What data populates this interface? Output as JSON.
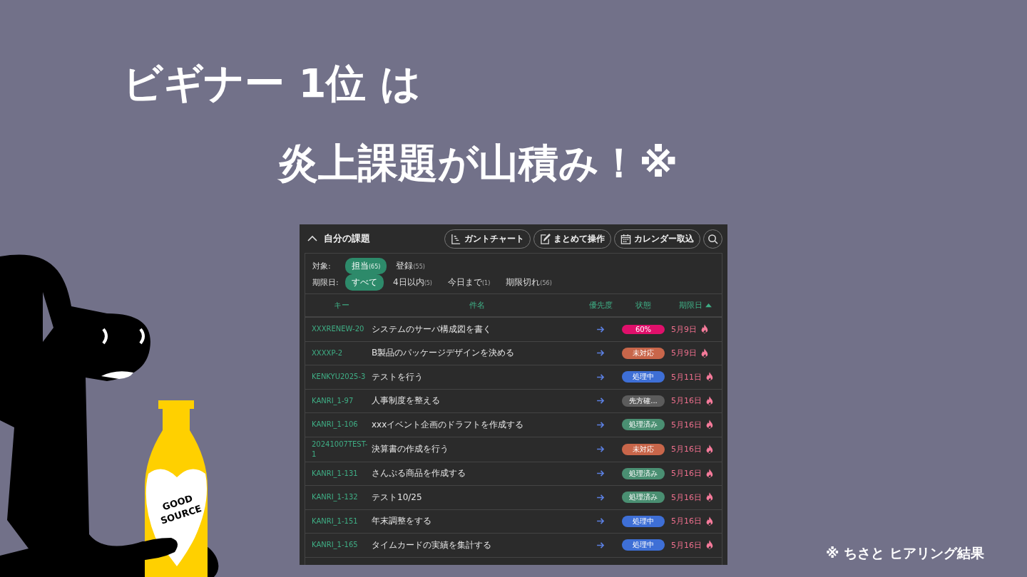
{
  "slide": {
    "title_line_1": "ビギナー 1位 は",
    "title_line_2": "炎上課題が山積み！※",
    "footnote": "※ ちさと ヒアリング結果",
    "bottle_label": [
      "GOOD",
      "SOURCE"
    ]
  },
  "panel": {
    "title": "自分の課題",
    "expanded": true,
    "toolbar": [
      {
        "kind": "gantt",
        "label": "ガントチャート"
      },
      {
        "kind": "bulk",
        "label": "まとめて操作"
      },
      {
        "kind": "calendar",
        "label": "カレンダー取込"
      },
      {
        "kind": "search"
      }
    ],
    "filters": [
      {
        "label": "対象:",
        "options": [
          {
            "label": "担当",
            "count": "(65)",
            "selected": true
          },
          {
            "label": "登録",
            "count": "(55)",
            "selected": false
          }
        ]
      },
      {
        "label": "期限日:",
        "options": [
          {
            "label": "すべて",
            "selected": true
          },
          {
            "label": "4日以内",
            "count": "(5)",
            "selected": false
          },
          {
            "label": "今日まで",
            "count": "(1)",
            "selected": false
          },
          {
            "label": "期限切れ",
            "count": "(56)",
            "selected": false
          }
        ]
      }
    ],
    "table": {
      "columns": [
        {
          "label": "キー"
        },
        {
          "label": "件名"
        },
        {
          "label": "優先度"
        },
        {
          "label": "状態"
        },
        {
          "label": "期限日",
          "sorted": true
        }
      ],
      "rows": [
        {
          "key": "XXXRENEW-20",
          "title": "システムのサーバ構成図を書く",
          "status": "60%",
          "color": "#e0106b",
          "due": "5月9日"
        },
        {
          "key": "XXXXP-2",
          "title": "B製品のパッケージデザインを決める",
          "status": "未対応",
          "color": "#c8664a",
          "due": "5月9日"
        },
        {
          "key": "KENKYU2025-3",
          "title": "テストを行う",
          "status": "処理中",
          "color": "#3e6fd6",
          "due": "5月11日"
        },
        {
          "key": "KANRI_1-97",
          "title": "人事制度を整える",
          "status": "先方確...",
          "color": "#5c5c5c",
          "due": "5月16日"
        },
        {
          "key": "KANRI_1-106",
          "title": "xxxイベント企画のドラフトを作成する",
          "status": "処理済み",
          "color": "#4a8f72",
          "due": "5月16日"
        },
        {
          "key": "20241007TEST-1",
          "title": "決算書の作成を行う",
          "status": "未対応",
          "color": "#c8664a",
          "due": "5月16日"
        },
        {
          "key": "KANRI_1-131",
          "title": "さんぷる商品を作成する",
          "status": "処理済み",
          "color": "#4a8f72",
          "due": "5月16日"
        },
        {
          "key": "KANRI_1-132",
          "title": "テスト10/25",
          "status": "処理済み",
          "color": "#4a8f72",
          "due": "5月16日"
        },
        {
          "key": "KANRI_1-151",
          "title": "年末調整をする",
          "status": "処理中",
          "color": "#3e6fd6",
          "due": "5月16日"
        },
        {
          "key": "KANRI_1-165",
          "title": "タイムカードの実績を集計する",
          "status": "処理中",
          "color": "#3e6fd6",
          "due": "5月16日"
        }
      ]
    }
  }
}
